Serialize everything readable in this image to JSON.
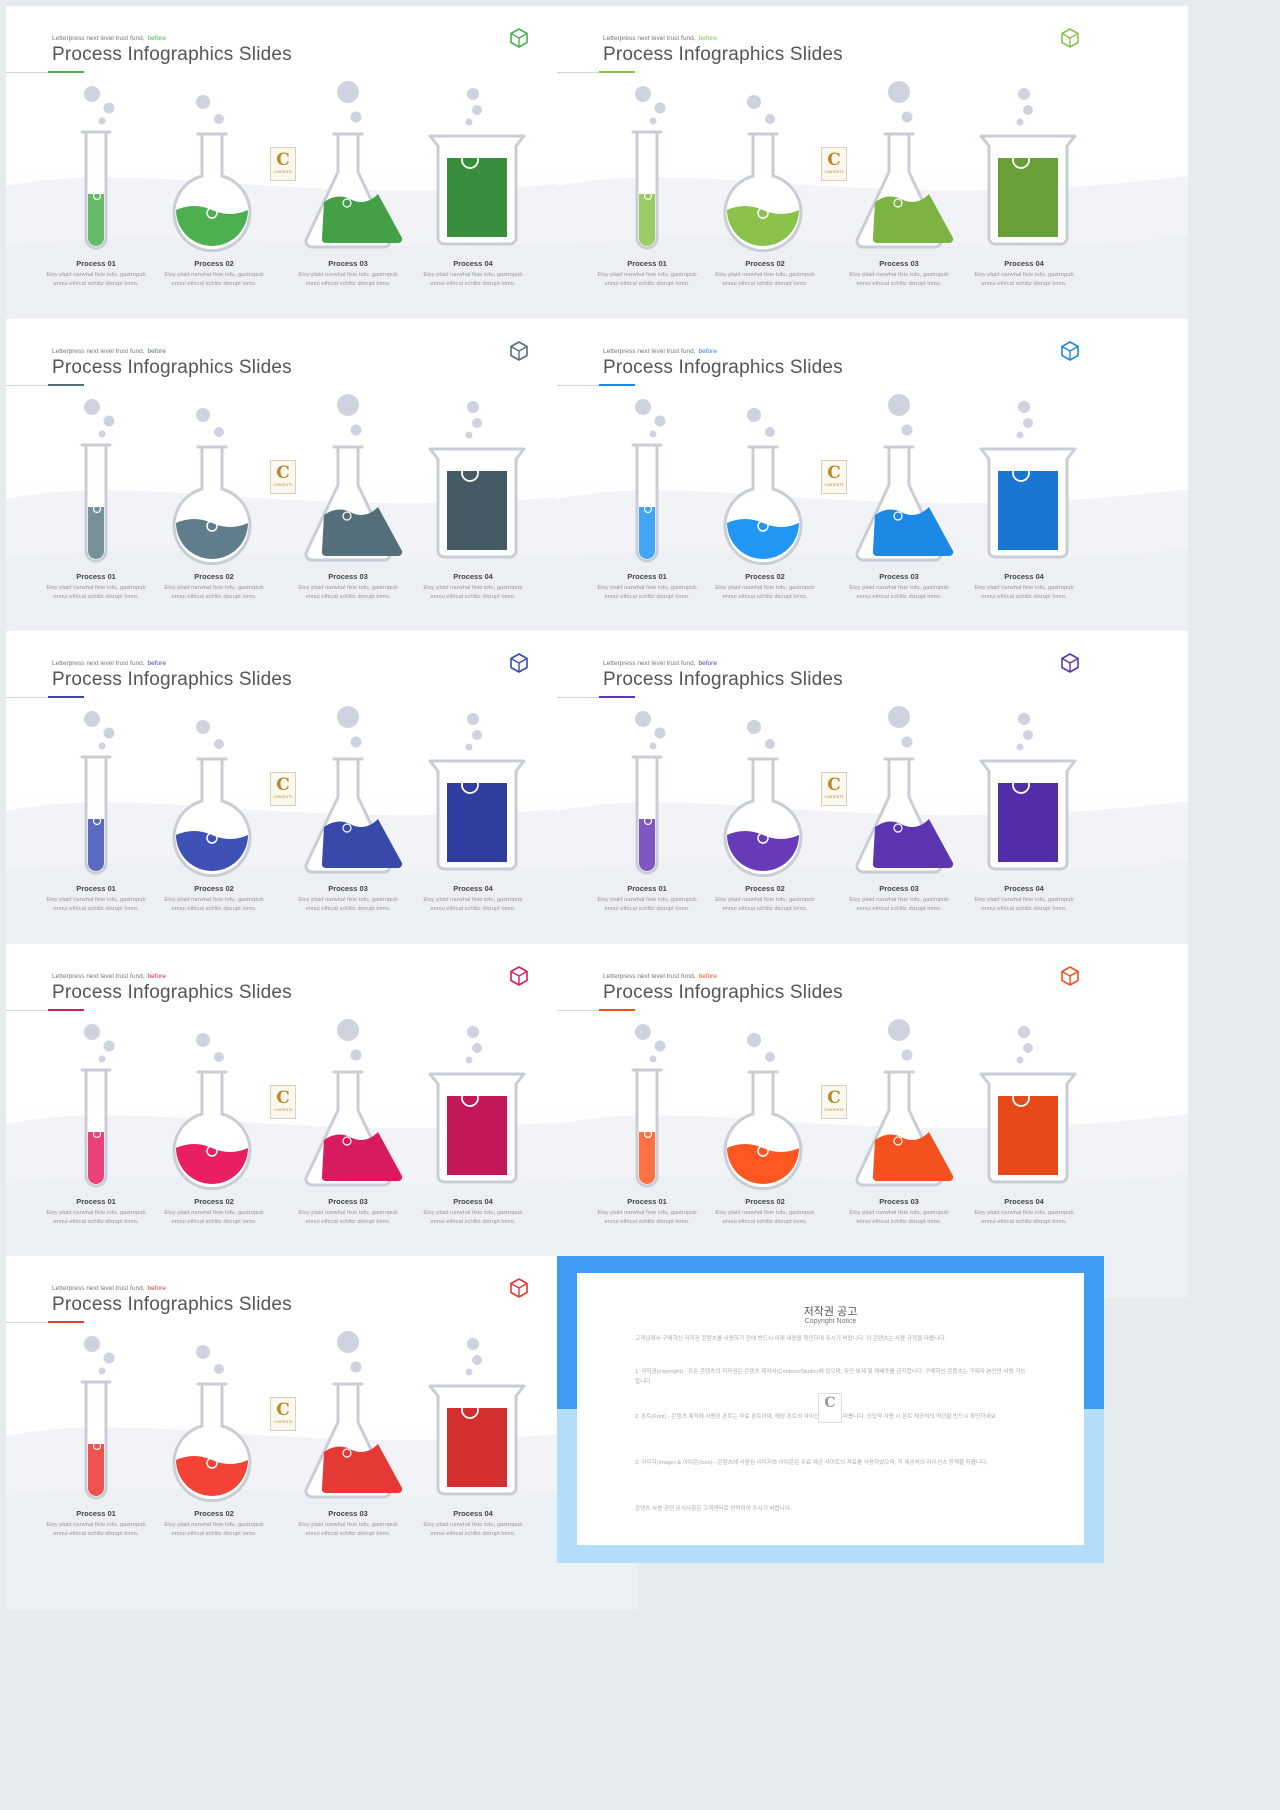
{
  "slide_text": {
    "kicker": "Letterpress next level trust fund,",
    "kicker_accent": "before",
    "title": "Process Infographics Slides",
    "stamp_letter": "C",
    "stamp_text": "CONTENTS",
    "steps": [
      {
        "label": "Process 01",
        "desc1": "Etsy plaid narwhal fixie tofu, gastropub",
        "desc2": "ennui ethical schlitz disrupt lomo."
      },
      {
        "label": "Process 02",
        "desc1": "Etsy plaid narwhal fixie tofu, gastropub",
        "desc2": "ennui ethical schlitz disrupt lomo."
      },
      {
        "label": "Process 03",
        "desc1": "Etsy plaid narwhal fixie tofu, gastropub",
        "desc2": "ennui ethical schlitz disrupt lomo."
      },
      {
        "label": "Process 04",
        "desc1": "Etsy plaid narwhal fixie tofu, gastropub",
        "desc2": "ennui ethical schlitz disrupt lomo."
      }
    ]
  },
  "slides": [
    {
      "theme": "green",
      "accent": "#4caf50",
      "icon": "cube-icon",
      "fills": [
        "#66bb6a",
        "#4caf50",
        "#43a047",
        "#388e3c"
      ]
    },
    {
      "theme": "lime",
      "accent": "#8bc34a",
      "icon": "cube-icon",
      "fills": [
        "#9ccc65",
        "#8bc34a",
        "#7cb342",
        "#689f38"
      ]
    },
    {
      "theme": "slate",
      "accent": "#546e7a",
      "icon": "cube-icon",
      "fills": [
        "#78909c",
        "#607d8b",
        "#546e7a",
        "#455a64"
      ]
    },
    {
      "theme": "blue",
      "accent": "#1e88e5",
      "icon": "cube-icon",
      "fills": [
        "#42a5f5",
        "#2196f3",
        "#1e88e5",
        "#1976d2"
      ]
    },
    {
      "theme": "indigo",
      "accent": "#3949ab",
      "icon": "cube-icon",
      "fills": [
        "#5c6bc0",
        "#3f51b5",
        "#3949ab",
        "#303f9f"
      ]
    },
    {
      "theme": "purple",
      "accent": "#5e35b1",
      "icon": "cube-icon",
      "fills": [
        "#7e57c2",
        "#673ab7",
        "#5e35b1",
        "#512da8"
      ]
    },
    {
      "theme": "pink",
      "accent": "#d81b60",
      "icon": "cube-icon",
      "fills": [
        "#ec407a",
        "#e91e63",
        "#d81b60",
        "#c2185b"
      ]
    },
    {
      "theme": "orange",
      "accent": "#f4511e",
      "icon": "cube-icon",
      "fills": [
        "#ff7043",
        "#ff5722",
        "#f4511e",
        "#e64a19"
      ]
    },
    {
      "theme": "red",
      "accent": "#e53935",
      "icon": "cube-icon",
      "fills": [
        "#ef5350",
        "#f44336",
        "#e53935",
        "#d32f2f"
      ]
    }
  ],
  "copyright": {
    "title": "저작권 공고",
    "subtitle": "Copyright Notice",
    "paragraphs": [
      "고객님께서 구매하신 저작권 콘텐츠를 사용하기 전에 반드시 아래 내용을 확인하여 주시기 바랍니다. 이 콘텐츠는 사용 규정을 따릅니다.",
      "1. 저작권(copyright) - 모든 콘텐츠의 저작권은 콘텐츠 제작사(ContentsStudio)에 있으며, 무단 복제 및 재배포를 금지합니다. 구매하신 콘텐츠는 구매자 본인만 사용 가능합니다.",
      "2. 폰트(Font) - 콘텐츠 제작에 사용된 폰트는 무료 폰트이며, 해당 폰트의 라이선스 정책을 따릅니다. 상업적 사용 시 폰트 제공처의 약관을 반드시 확인하세요.",
      "3. 이미지(Image) & 아이콘(Icon) - 콘텐츠에 사용된 이미지와 아이콘은 무료 제공 사이트의 자료를 사용하였으며, 각 제공처의 라이선스 정책을 따릅니다.",
      "콘텐츠 사용 관련 문의사항은 고객센터로 연락하여 주시기 바랍니다."
    ]
  }
}
